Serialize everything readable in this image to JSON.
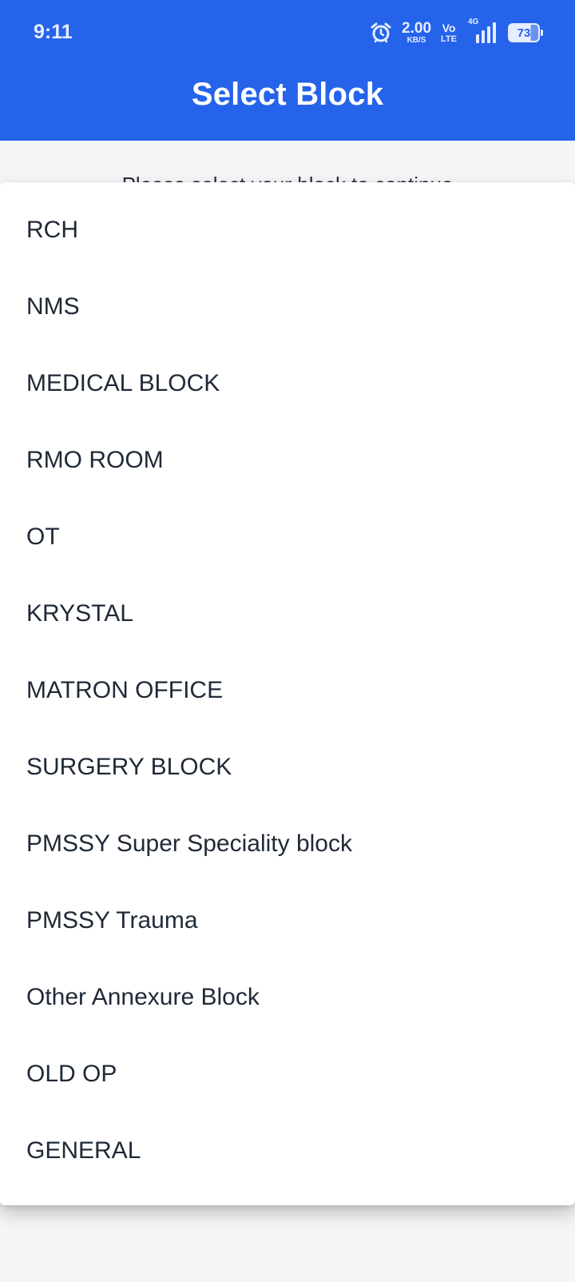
{
  "status_bar": {
    "time": "9:11",
    "net_speed_value": "2.00",
    "net_speed_unit": "KB/S",
    "volte_top": "Vo",
    "volte_bottom": "LTE",
    "network_type": "4G",
    "battery_level": "73",
    "icons": [
      "alarm-icon",
      "signal-icon",
      "battery-icon"
    ]
  },
  "header": {
    "title": "Select Block"
  },
  "background": {
    "hint": "Please select your block to continue"
  },
  "dropdown": {
    "items": [
      {
        "label": "RCH"
      },
      {
        "label": "NMS"
      },
      {
        "label": "MEDICAL BLOCK"
      },
      {
        "label": "RMO ROOM"
      },
      {
        "label": "OT"
      },
      {
        "label": "KRYSTAL"
      },
      {
        "label": "MATRON OFFICE"
      },
      {
        "label": "SURGERY BLOCK"
      },
      {
        "label": "PMSSY Super Speciality block"
      },
      {
        "label": "PMSSY Trauma"
      },
      {
        "label": "Other Annexure Block"
      },
      {
        "label": "OLD OP"
      },
      {
        "label": "GENERAL"
      }
    ]
  },
  "colors": {
    "header_bg": "#2563eb",
    "page_bg": "#f4f5f7",
    "item_text": "#1f2937"
  }
}
